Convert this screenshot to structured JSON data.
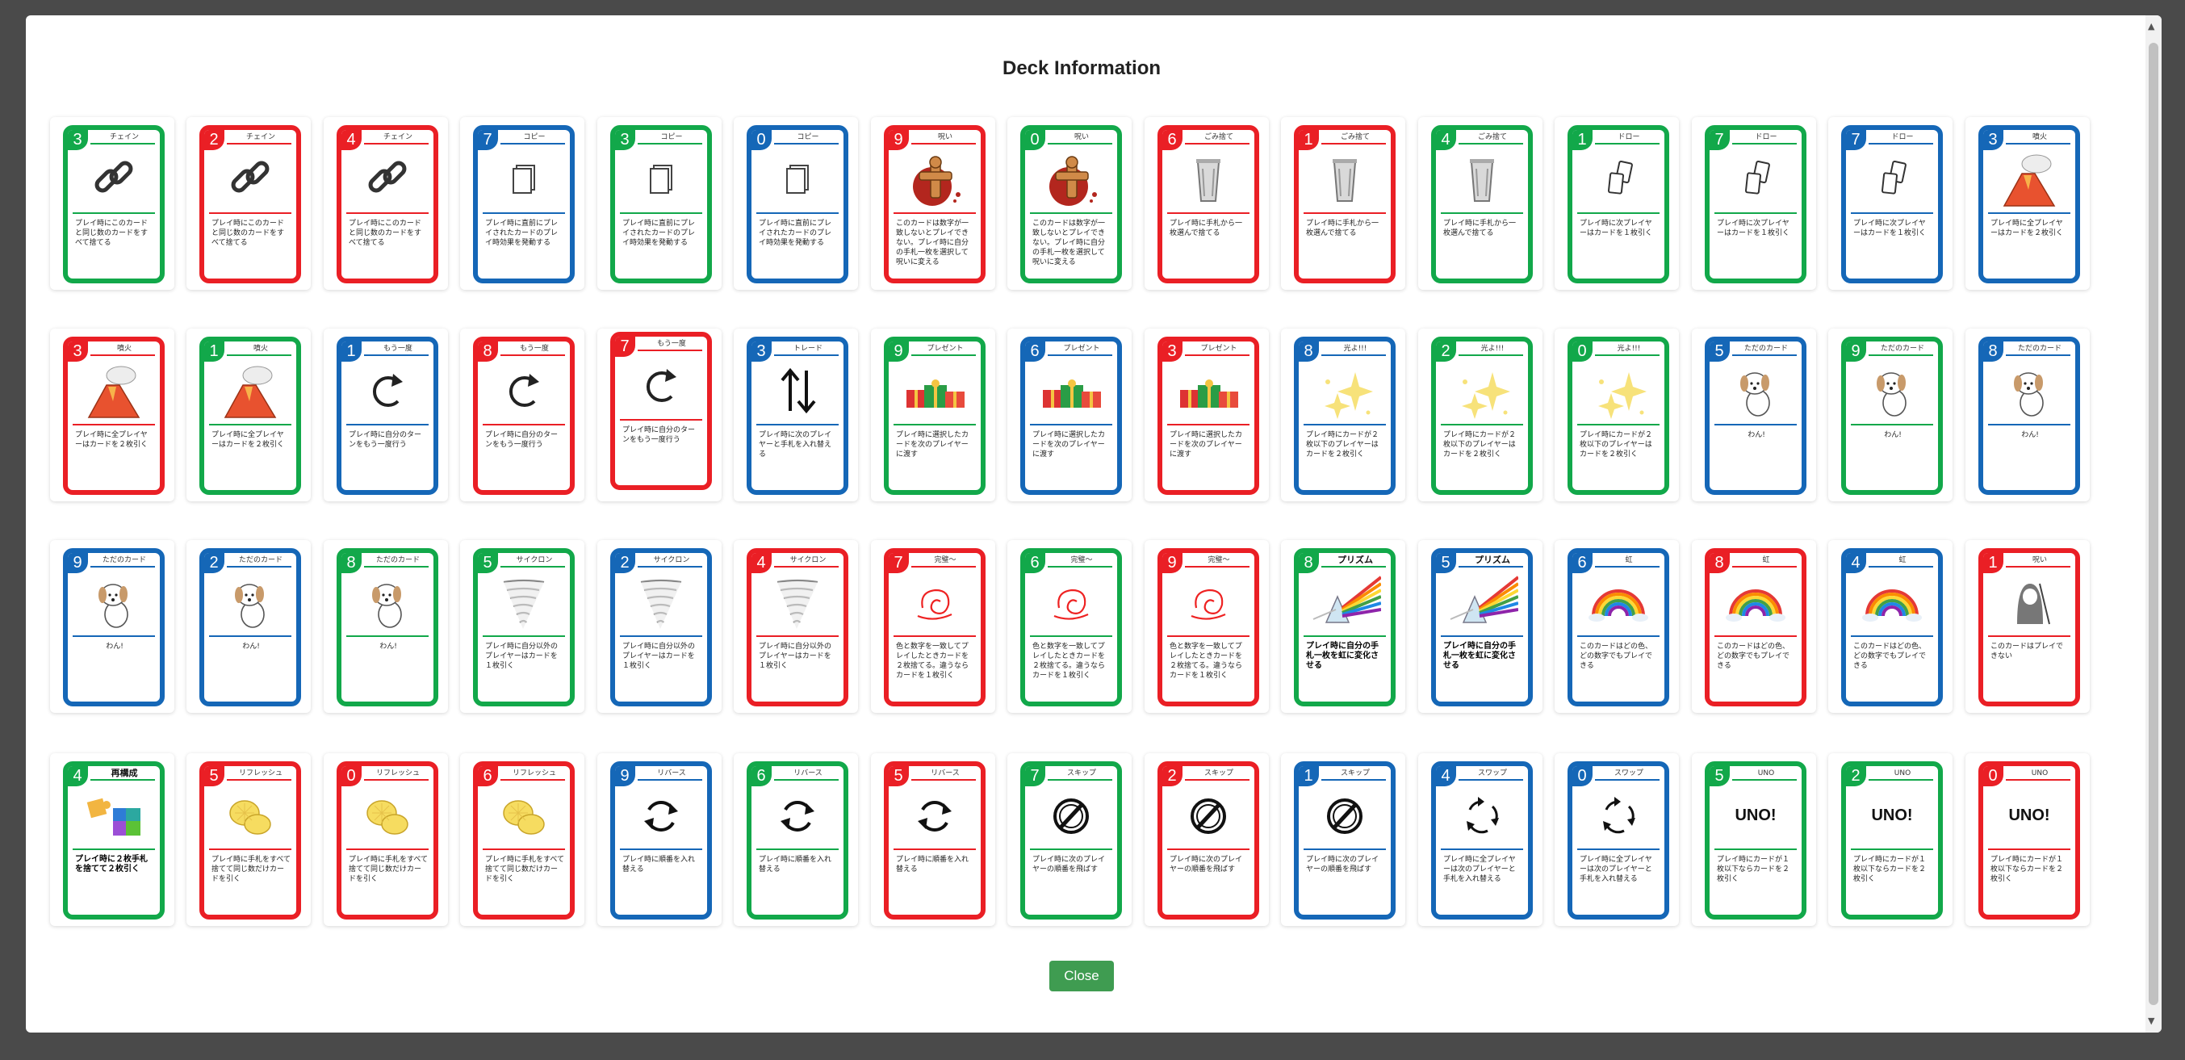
{
  "dialog": {
    "title": "Deck Information",
    "close_label": "Close"
  },
  "colors": {
    "green": "#12a84a",
    "red": "#ea1f25",
    "blue": "#1567b7",
    "close_button": "#3f9c51"
  },
  "rows": [
    [
      {
        "number": "3",
        "color": "green",
        "name": "チェイン",
        "icon": "chain-icon",
        "text": "プレイ時にこのカードと同じ数のカードをすべて捨てる"
      },
      {
        "number": "2",
        "color": "red",
        "name": "チェイン",
        "icon": "chain-icon",
        "text": "プレイ時にこのカードと同じ数のカードをすべて捨てる"
      },
      {
        "number": "4",
        "color": "red",
        "name": "チェイン",
        "icon": "chain-icon",
        "text": "プレイ時にこのカードと同じ数のカードをすべて捨てる"
      },
      {
        "number": "7",
        "color": "blue",
        "name": "コピー",
        "icon": "copy-icon",
        "text": "プレイ時に直前にプレイされたカードのプレイ時効果を発動する"
      },
      {
        "number": "3",
        "color": "green",
        "name": "コピー",
        "icon": "copy-icon",
        "text": "プレイ時に直前にプレイされたカードのプレイ時効果を発動する"
      },
      {
        "number": "0",
        "color": "blue",
        "name": "コピー",
        "icon": "copy-icon",
        "text": "プレイ時に直前にプレイされたカードのプレイ時効果を発動する"
      },
      {
        "number": "9",
        "color": "red",
        "name": "呪い",
        "icon": "curse-doll-icon",
        "text": "このカードは数字が一致しないとプレイできない。プレイ時に自分の手札一枚を選択して呪いに変える"
      },
      {
        "number": "0",
        "color": "green",
        "name": "呪い",
        "icon": "curse-doll-icon",
        "text": "このカードは数字が一致しないとプレイできない。プレイ時に自分の手札一枚を選択して呪いに変える"
      },
      {
        "number": "6",
        "color": "red",
        "name": "ごみ捨て",
        "icon": "trash-can-icon",
        "text": "プレイ時に手札から一枚選んで捨てる"
      },
      {
        "number": "1",
        "color": "red",
        "name": "ごみ捨て",
        "icon": "trash-can-icon",
        "text": "プレイ時に手札から一枚選んで捨てる"
      },
      {
        "number": "4",
        "color": "green",
        "name": "ごみ捨て",
        "icon": "trash-can-icon",
        "text": "プレイ時に手札から一枚選んで捨てる"
      },
      {
        "number": "1",
        "color": "green",
        "name": "ドロー",
        "icon": "draw-cards-icon",
        "text": "プレイ時に次プレイヤーはカードを１枚引く"
      },
      {
        "number": "7",
        "color": "green",
        "name": "ドロー",
        "icon": "draw-cards-icon",
        "text": "プレイ時に次プレイヤーはカードを１枚引く"
      },
      {
        "number": "7",
        "color": "blue",
        "name": "ドロー",
        "icon": "draw-cards-icon",
        "text": "プレイ時に次プレイヤーはカードを１枚引く"
      },
      {
        "number": "3",
        "color": "blue",
        "name": "噴火",
        "icon": "volcano-icon",
        "text": "プレイ時に全プレイヤーはカードを２枚引く"
      }
    ],
    [
      {
        "number": "3",
        "color": "red",
        "name": "噴火",
        "icon": "volcano-icon",
        "text": "プレイ時に全プレイヤーはカードを２枚引く"
      },
      {
        "number": "1",
        "color": "green",
        "name": "噴火",
        "icon": "volcano-icon",
        "text": "プレイ時に全プレイヤーはカードを２枚引く"
      },
      {
        "number": "1",
        "color": "blue",
        "name": "もう一度",
        "icon": "repeat-arrow-icon",
        "text": "プレイ時に自分のターンをもう一度行う"
      },
      {
        "number": "8",
        "color": "red",
        "name": "もう一度",
        "icon": "repeat-arrow-icon",
        "text": "プレイ時に自分のターンをもう一度行う"
      },
      {
        "number": "7",
        "color": "red",
        "name": "もう一度",
        "icon": "repeat-arrow-icon",
        "text": "プレイ時に自分のターンをもう一度行う",
        "tilt": true
      },
      {
        "number": "3",
        "color": "blue",
        "name": "トレード",
        "icon": "swap-arrows-icon",
        "text": "プレイ時に次のプレイヤーと手札を入れ替える"
      },
      {
        "number": "9",
        "color": "green",
        "name": "プレゼント",
        "icon": "gift-icon",
        "text": "プレイ時に選択したカードを次のプレイヤーに渡す"
      },
      {
        "number": "6",
        "color": "blue",
        "name": "プレゼント",
        "icon": "gift-icon",
        "text": "プレイ時に選択したカードを次のプレイヤーに渡す"
      },
      {
        "number": "3",
        "color": "red",
        "name": "プレゼント",
        "icon": "gift-icon",
        "text": "プレイ時に選択したカードを次のプレイヤーに渡す"
      },
      {
        "number": "8",
        "color": "blue",
        "name": "光よ!!!",
        "icon": "sparkle-icon",
        "text": "プレイ時にカードが２枚以下のプレイヤーはカードを２枚引く"
      },
      {
        "number": "2",
        "color": "green",
        "name": "光よ!!!",
        "icon": "sparkle-icon",
        "text": "プレイ時にカードが２枚以下のプレイヤーはカードを２枚引く"
      },
      {
        "number": "0",
        "color": "green",
        "name": "光よ!!!",
        "icon": "sparkle-icon",
        "text": "プレイ時にカードが２枚以下のプレイヤーはカードを２枚引く"
      },
      {
        "number": "5",
        "color": "blue",
        "name": "ただのカード",
        "icon": "dog-icon",
        "text": "わん!",
        "center": true
      },
      {
        "number": "9",
        "color": "green",
        "name": "ただのカード",
        "icon": "dog-icon",
        "text": "わん!",
        "center": true
      },
      {
        "number": "8",
        "color": "blue",
        "name": "ただのカード",
        "icon": "dog-icon",
        "text": "わん!",
        "center": true
      }
    ],
    [
      {
        "number": "9",
        "color": "blue",
        "name": "ただのカード",
        "icon": "dog-icon",
        "text": "わん!",
        "center": true
      },
      {
        "number": "2",
        "color": "blue",
        "name": "ただのカード",
        "icon": "dog-icon",
        "text": "わん!",
        "center": true
      },
      {
        "number": "8",
        "color": "green",
        "name": "ただのカード",
        "icon": "dog-icon",
        "text": "わん!",
        "center": true
      },
      {
        "number": "5",
        "color": "green",
        "name": "サイクロン",
        "icon": "tornado-icon",
        "text": "プレイ時に自分以外のプレイヤーはカードを１枚引く"
      },
      {
        "number": "2",
        "color": "blue",
        "name": "サイクロン",
        "icon": "tornado-icon",
        "text": "プレイ時に自分以外のプレイヤーはカードを１枚引く"
      },
      {
        "number": "4",
        "color": "red",
        "name": "サイクロン",
        "icon": "tornado-icon",
        "text": "プレイ時に自分以外のプレイヤーはカードを１枚引く"
      },
      {
        "number": "7",
        "color": "red",
        "name": "完璧～",
        "icon": "swirl-cloud-icon",
        "text": "色と数字を一致してプレイしたときカードを２枚捨てる。違うならカードを１枚引く"
      },
      {
        "number": "6",
        "color": "green",
        "name": "完璧～",
        "icon": "swirl-cloud-icon",
        "text": "色と数字を一致してプレイしたときカードを２枚捨てる。違うならカードを１枚引く"
      },
      {
        "number": "9",
        "color": "red",
        "name": "完璧～",
        "icon": "swirl-cloud-icon",
        "text": "色と数字を一致してプレイしたときカードを２枚捨てる。違うならカードを１枚引く"
      },
      {
        "number": "8",
        "color": "green",
        "name": "プリズム",
        "icon": "prism-icon",
        "text": "プレイ時に自分の手札一枚を虹に変化させる",
        "bigname": true,
        "boldtext": true
      },
      {
        "number": "5",
        "color": "blue",
        "name": "プリズム",
        "icon": "prism-icon",
        "text": "プレイ時に自分の手札一枚を虹に変化させる",
        "bigname": true,
        "boldtext": true
      },
      {
        "number": "6",
        "color": "blue",
        "name": "虹",
        "icon": "rainbow-icon",
        "text": "このカードはどの色、どの数字でもプレイできる"
      },
      {
        "number": "8",
        "color": "red",
        "name": "虹",
        "icon": "rainbow-icon",
        "text": "このカードはどの色、どの数字でもプレイできる"
      },
      {
        "number": "4",
        "color": "blue",
        "name": "虹",
        "icon": "rainbow-icon",
        "text": "このカードはどの色、どの数字でもプレイできる"
      },
      {
        "number": "1",
        "color": "red",
        "name": "呪い",
        "icon": "ghost-icon",
        "text": "このカードはプレイできない"
      }
    ],
    [
      {
        "number": "4",
        "color": "green",
        "name": "再構成",
        "icon": "puzzle-icon",
        "text": "プレイ時に２枚手札を捨てて２枚引く",
        "bigname": true,
        "boldtext": true
      },
      {
        "number": "5",
        "color": "red",
        "name": "リフレッシュ",
        "icon": "lemon-icon",
        "text": "プレイ時に手札をすべて捨てて同じ数だけカードを引く"
      },
      {
        "number": "0",
        "color": "red",
        "name": "リフレッシュ",
        "icon": "lemon-icon",
        "text": "プレイ時に手札をすべて捨てて同じ数だけカードを引く"
      },
      {
        "number": "6",
        "color": "red",
        "name": "リフレッシュ",
        "icon": "lemon-icon",
        "text": "プレイ時に手札をすべて捨てて同じ数だけカードを引く"
      },
      {
        "number": "9",
        "color": "blue",
        "name": "リバース",
        "icon": "reverse-icon",
        "text": "プレイ時に順番を入れ替える"
      },
      {
        "number": "6",
        "color": "green",
        "name": "リバース",
        "icon": "reverse-icon",
        "text": "プレイ時に順番を入れ替える"
      },
      {
        "number": "5",
        "color": "red",
        "name": "リバース",
        "icon": "reverse-icon",
        "text": "プレイ時に順番を入れ替える"
      },
      {
        "number": "7",
        "color": "green",
        "name": "スキップ",
        "icon": "skip-icon",
        "text": "プレイ時に次のプレイヤーの順番を飛ばす"
      },
      {
        "number": "2",
        "color": "red",
        "name": "スキップ",
        "icon": "skip-icon",
        "text": "プレイ時に次のプレイヤーの順番を飛ばす"
      },
      {
        "number": "1",
        "color": "blue",
        "name": "スキップ",
        "icon": "skip-icon",
        "text": "プレイ時に次のプレイヤーの順番を飛ばす"
      },
      {
        "number": "4",
        "color": "blue",
        "name": "スワップ",
        "icon": "rotate-icon",
        "text": "プレイ時に全プレイヤーは次のプレイヤーと手札を入れ替える"
      },
      {
        "number": "0",
        "color": "blue",
        "name": "スワップ",
        "icon": "rotate-icon",
        "text": "プレイ時に全プレイヤーは次のプレイヤーと手札を入れ替える"
      },
      {
        "number": "5",
        "color": "green",
        "name": "UNO",
        "icon": "uno-text-icon",
        "icon_text": "UNO!",
        "text": "プレイ時にカードが１枚以下ならカードを２枚引く"
      },
      {
        "number": "2",
        "color": "green",
        "name": "UNO",
        "icon": "uno-text-icon",
        "icon_text": "UNO!",
        "text": "プレイ時にカードが１枚以下ならカードを２枚引く"
      },
      {
        "number": "0",
        "color": "red",
        "name": "UNO",
        "icon": "uno-text-icon",
        "icon_text": "UNO!",
        "text": "プレイ時にカードが１枚以下ならカードを２枚引く"
      }
    ]
  ]
}
